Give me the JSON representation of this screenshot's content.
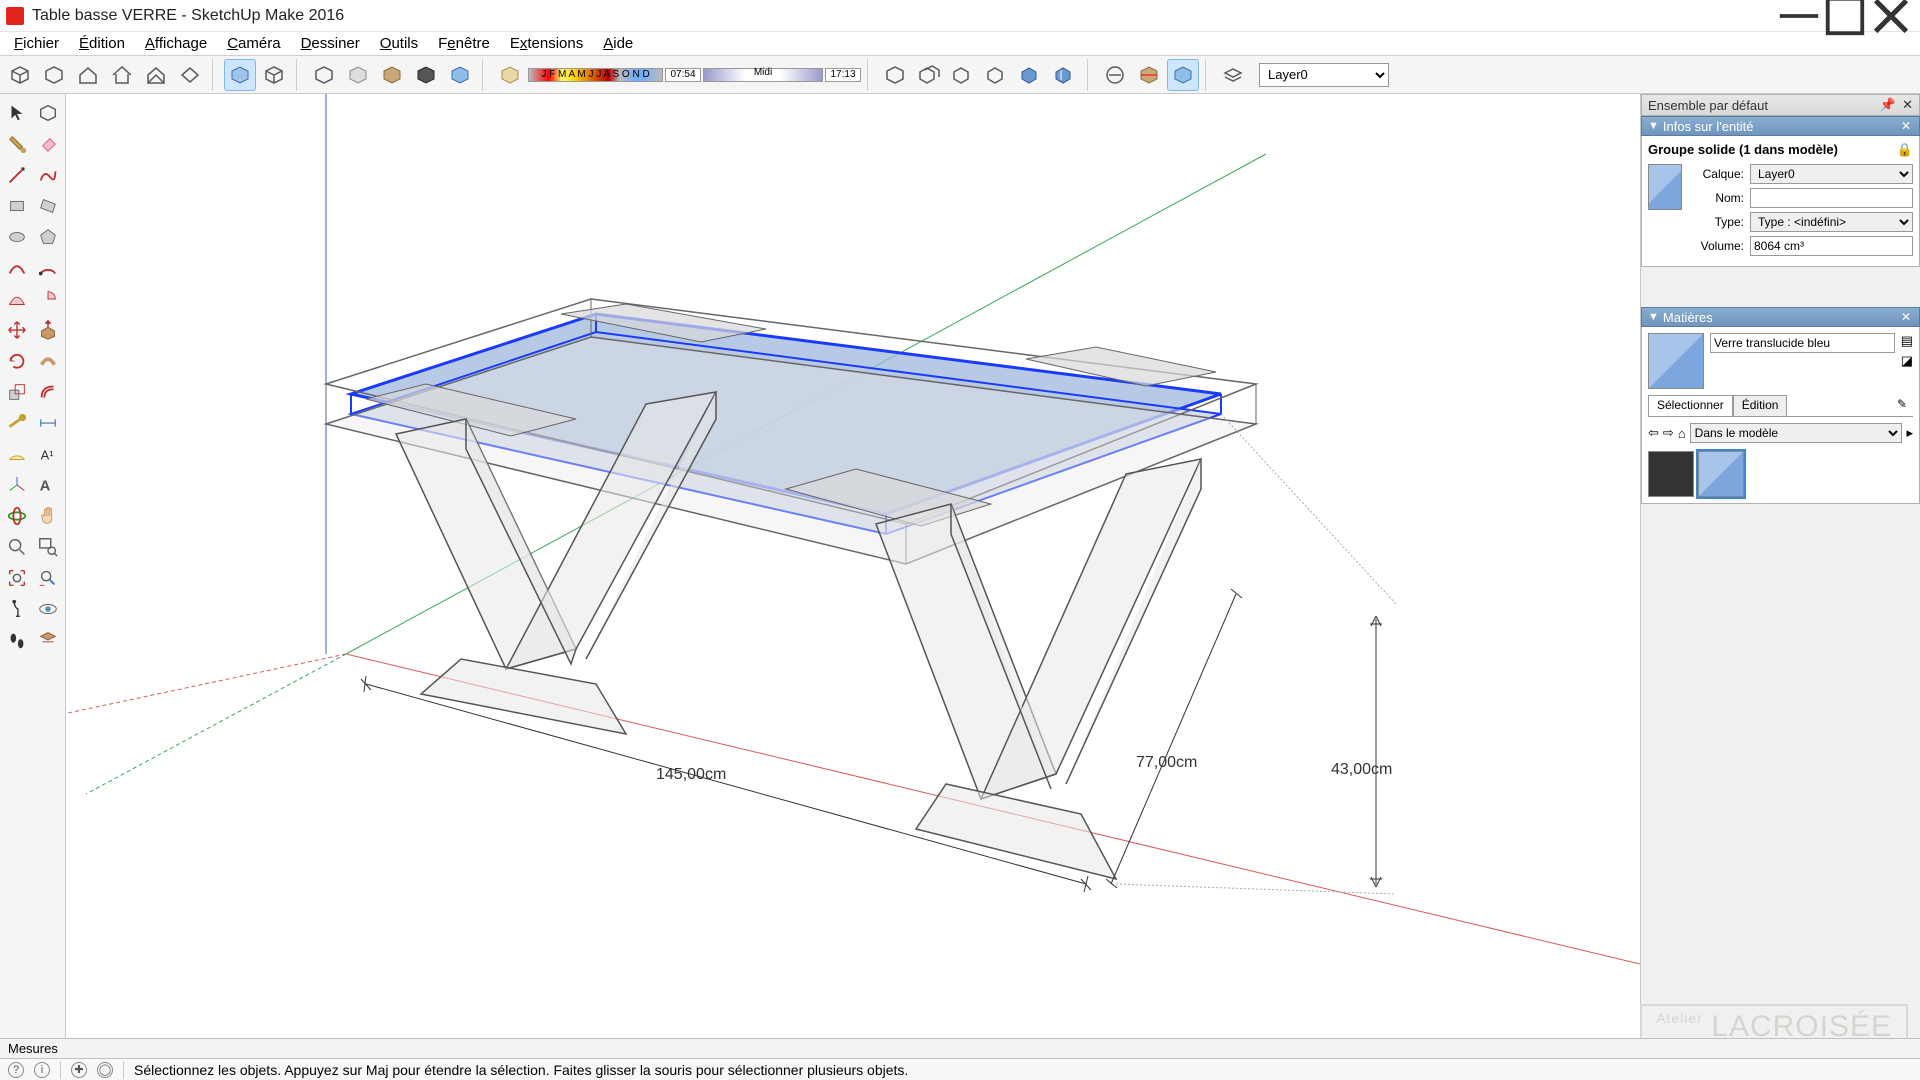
{
  "window": {
    "title": "Table basse VERRE - SketchUp Make 2016"
  },
  "menu": [
    "Fichier",
    "Édition",
    "Affichage",
    "Caméra",
    "Dessiner",
    "Outils",
    "Fenêtre",
    "Extensions",
    "Aide"
  ],
  "shadow": {
    "months": "J F M A M J J A S O N D",
    "time_start": "07:54",
    "midday": "Midi",
    "time_end": "17:13"
  },
  "layer_selector": "Layer0",
  "dimensions": {
    "length": "145,00cm",
    "width": "77,00cm",
    "height": "43,00cm"
  },
  "panels": {
    "default_set": "Ensemble par défaut",
    "entity_info": {
      "title": "Infos sur l'entité",
      "heading": "Groupe solide (1 dans modèle)",
      "layer_label": "Calque:",
      "layer_value": "Layer0",
      "name_label": "Nom:",
      "name_value": "",
      "type_label": "Type:",
      "type_value": "Type : <indéfini>",
      "volume_label": "Volume:",
      "volume_value": "8064 cm³"
    },
    "materials": {
      "title": "Matières",
      "current": "Verre translucide bleu",
      "tab_select": "Sélectionner",
      "tab_edit": "Édition",
      "scope": "Dans le modèle"
    }
  },
  "measures_label": "Mesures",
  "status_hint": "Sélectionnez les objets. Appuyez sur Maj pour étendre la sélection. Faites glisser la souris pour sélectionner plusieurs objets.",
  "watermark": "LACROISÉE"
}
